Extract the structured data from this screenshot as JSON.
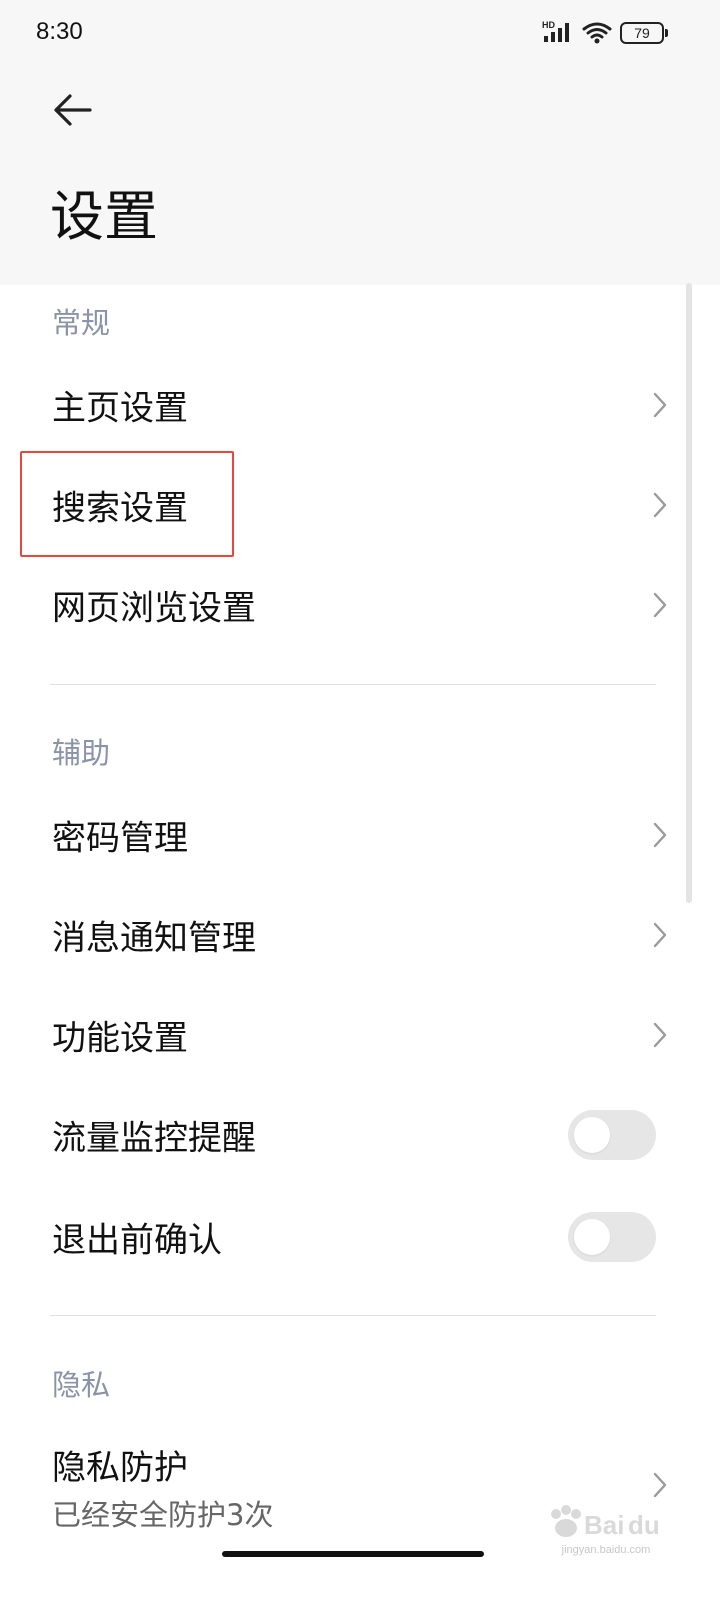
{
  "status_bar": {
    "time": "8:30",
    "battery": "79",
    "hd_label": "HD",
    "icons": [
      "signal-icon",
      "wifi-icon",
      "battery-icon"
    ]
  },
  "header": {
    "back_icon": "arrow-left-icon",
    "title": "设置"
  },
  "sections": {
    "general": {
      "title": "常规",
      "items": [
        {
          "label": "主页设置",
          "control": "chevron"
        },
        {
          "label": "搜索设置",
          "control": "chevron"
        },
        {
          "label": "网页浏览设置",
          "control": "chevron"
        }
      ]
    },
    "assist": {
      "title": "辅助",
      "items": [
        {
          "label": "密码管理",
          "control": "chevron"
        },
        {
          "label": "消息通知管理",
          "control": "chevron"
        },
        {
          "label": "功能设置",
          "control": "chevron"
        },
        {
          "label": "流量监控提醒",
          "control": "toggle",
          "on": false
        },
        {
          "label": "退出前确认",
          "control": "toggle",
          "on": false
        }
      ]
    },
    "privacy": {
      "title": "隐私",
      "items": [
        {
          "label": "隐私防护",
          "sublabel": "已经安全防护3次",
          "control": "chevron"
        }
      ]
    }
  },
  "watermark": {
    "text": "jingyan.baidu.com",
    "logo": "baidu-jingyan-logo"
  },
  "colors": {
    "highlight": "#e8473d",
    "section_title": "#8a93a8",
    "toggle_off": "#e6e6e6"
  }
}
